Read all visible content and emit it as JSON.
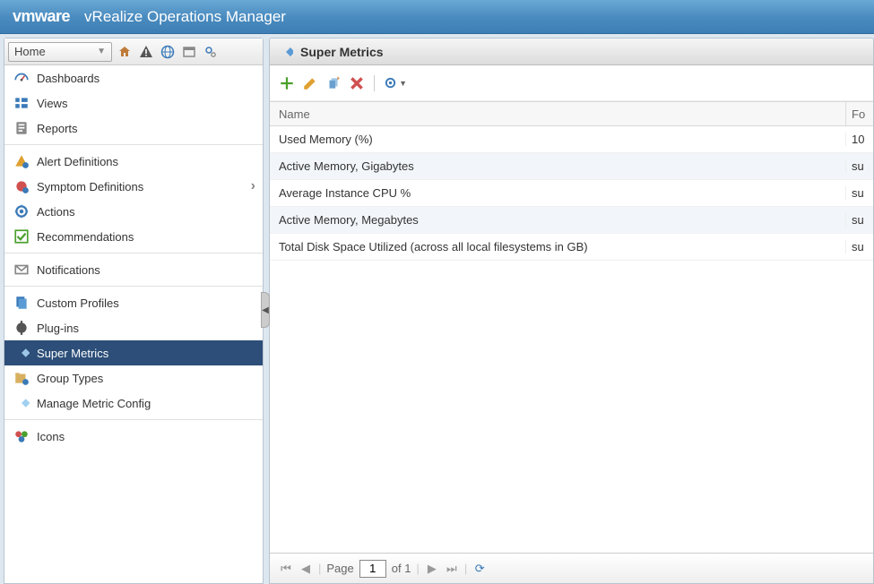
{
  "header": {
    "brand": "vmware",
    "product": "vRealize Operations Manager"
  },
  "sidebar": {
    "dropdown_label": "Home",
    "groups": [
      {
        "items": [
          {
            "icon": "dashboard",
            "label": "Dashboards"
          },
          {
            "icon": "views",
            "label": "Views"
          },
          {
            "icon": "reports",
            "label": "Reports"
          }
        ]
      },
      {
        "items": [
          {
            "icon": "alert-def",
            "label": "Alert Definitions"
          },
          {
            "icon": "symptom",
            "label": "Symptom Definitions",
            "has_children": true
          },
          {
            "icon": "actions",
            "label": "Actions"
          },
          {
            "icon": "recommend",
            "label": "Recommendations"
          }
        ]
      },
      {
        "items": [
          {
            "icon": "notifications",
            "label": "Notifications"
          }
        ]
      },
      {
        "items": [
          {
            "icon": "profiles",
            "label": "Custom Profiles"
          },
          {
            "icon": "plugins",
            "label": "Plug-ins"
          },
          {
            "icon": "super-metrics",
            "label": "Super Metrics",
            "selected": true
          },
          {
            "icon": "group-types",
            "label": "Group Types"
          },
          {
            "icon": "metric-config",
            "label": "Manage Metric Config"
          }
        ]
      },
      {
        "items": [
          {
            "icon": "icons",
            "label": "Icons"
          }
        ]
      }
    ]
  },
  "main": {
    "title": "Super Metrics",
    "columns": {
      "name": "Name",
      "formula": "Fo"
    },
    "rows": [
      {
        "name": "Used Memory (%)",
        "formula_preview": "10"
      },
      {
        "name": "Active Memory, Gigabytes",
        "formula_preview": "su"
      },
      {
        "name": "Average Instance CPU %",
        "formula_preview": "su"
      },
      {
        "name": "Active Memory, Megabytes",
        "formula_preview": "su"
      },
      {
        "name": "Total Disk Space Utilized (across all local filesystems in GB)",
        "formula_preview": "su"
      }
    ],
    "pager": {
      "label_page": "Page",
      "current": "1",
      "of_label": "of 1"
    }
  }
}
